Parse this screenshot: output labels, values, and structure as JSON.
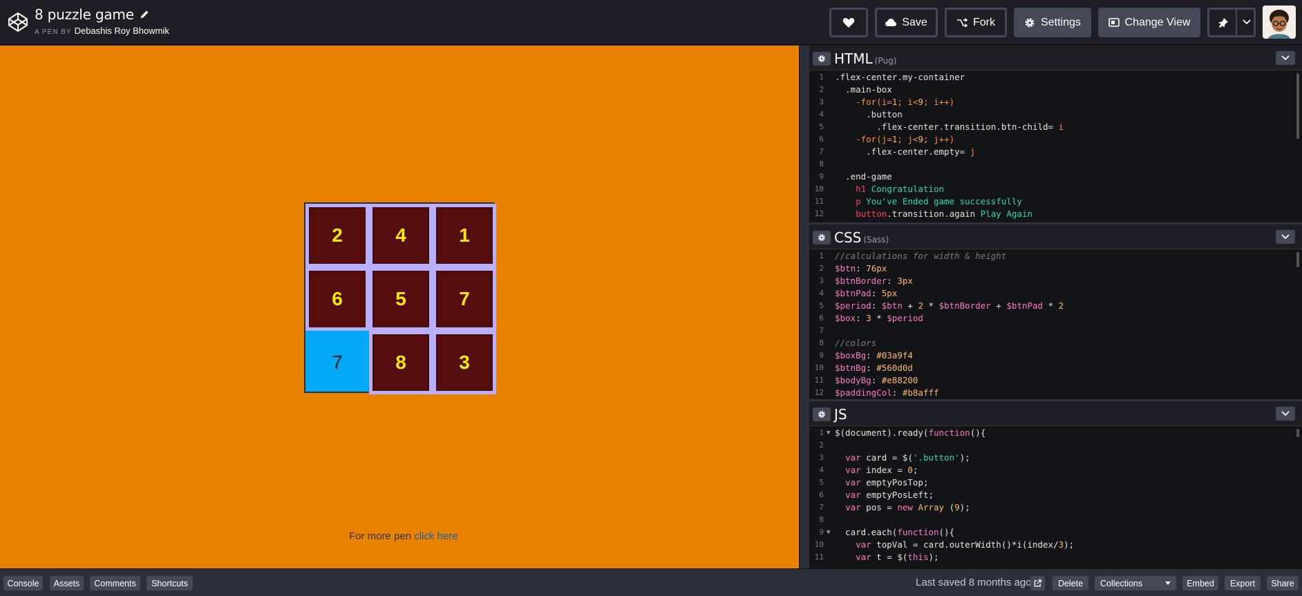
{
  "header": {
    "pen_title": "8 puzzle game",
    "byline_prefix": "A PEN BY",
    "author": "Debashis Roy Bhowmik",
    "save_label": "Save",
    "fork_label": "Fork",
    "settings_label": "Settings",
    "change_view_label": "Change View"
  },
  "preview": {
    "background": "#e88200",
    "puzzle_bg": "#03a9f4",
    "tile_bg": "#560d0d",
    "tile_pad": "#b8afff",
    "tiles": [
      "2",
      "4",
      "1",
      "6",
      "5",
      "7",
      "7",
      "8",
      "3"
    ],
    "empty_index": 6,
    "more_text": "For more pen ",
    "more_link": "click here"
  },
  "editors": {
    "html": {
      "title": "HTML",
      "sub": "(Pug)"
    },
    "css": {
      "title": "CSS",
      "sub": "(Sass)"
    },
    "js": {
      "title": "JS"
    }
  },
  "footer": {
    "console": "Console",
    "assets": "Assets",
    "comments": "Comments",
    "shortcuts": "Shortcuts",
    "last_saved": "Last saved 8 months ago",
    "delete": "Delete",
    "collections": "Collections",
    "embed": "Embed",
    "export": "Export",
    "share": "Share"
  }
}
